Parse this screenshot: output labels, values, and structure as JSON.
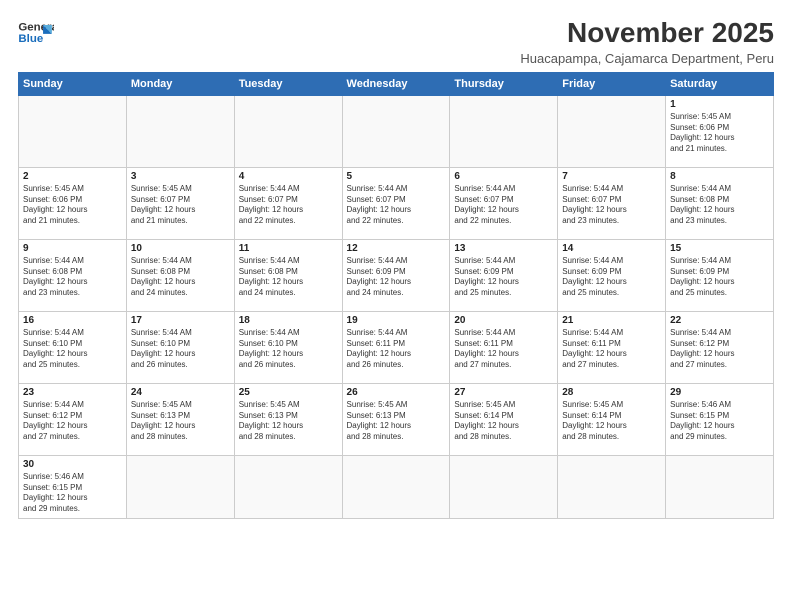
{
  "logo": {
    "line1": "General",
    "line2": "Blue"
  },
  "header": {
    "month_title": "November 2025",
    "subtitle": "Huacapampa, Cajamarca Department, Peru"
  },
  "weekdays": [
    "Sunday",
    "Monday",
    "Tuesday",
    "Wednesday",
    "Thursday",
    "Friday",
    "Saturday"
  ],
  "weeks": [
    [
      {
        "num": "",
        "info": ""
      },
      {
        "num": "",
        "info": ""
      },
      {
        "num": "",
        "info": ""
      },
      {
        "num": "",
        "info": ""
      },
      {
        "num": "",
        "info": ""
      },
      {
        "num": "",
        "info": ""
      },
      {
        "num": "1",
        "info": "Sunrise: 5:45 AM\nSunset: 6:06 PM\nDaylight: 12 hours\nand 21 minutes."
      }
    ],
    [
      {
        "num": "2",
        "info": "Sunrise: 5:45 AM\nSunset: 6:06 PM\nDaylight: 12 hours\nand 21 minutes."
      },
      {
        "num": "3",
        "info": "Sunrise: 5:45 AM\nSunset: 6:07 PM\nDaylight: 12 hours\nand 21 minutes."
      },
      {
        "num": "4",
        "info": "Sunrise: 5:44 AM\nSunset: 6:07 PM\nDaylight: 12 hours\nand 22 minutes."
      },
      {
        "num": "5",
        "info": "Sunrise: 5:44 AM\nSunset: 6:07 PM\nDaylight: 12 hours\nand 22 minutes."
      },
      {
        "num": "6",
        "info": "Sunrise: 5:44 AM\nSunset: 6:07 PM\nDaylight: 12 hours\nand 22 minutes."
      },
      {
        "num": "7",
        "info": "Sunrise: 5:44 AM\nSunset: 6:07 PM\nDaylight: 12 hours\nand 23 minutes."
      },
      {
        "num": "8",
        "info": "Sunrise: 5:44 AM\nSunset: 6:08 PM\nDaylight: 12 hours\nand 23 minutes."
      }
    ],
    [
      {
        "num": "9",
        "info": "Sunrise: 5:44 AM\nSunset: 6:08 PM\nDaylight: 12 hours\nand 23 minutes."
      },
      {
        "num": "10",
        "info": "Sunrise: 5:44 AM\nSunset: 6:08 PM\nDaylight: 12 hours\nand 24 minutes."
      },
      {
        "num": "11",
        "info": "Sunrise: 5:44 AM\nSunset: 6:08 PM\nDaylight: 12 hours\nand 24 minutes."
      },
      {
        "num": "12",
        "info": "Sunrise: 5:44 AM\nSunset: 6:09 PM\nDaylight: 12 hours\nand 24 minutes."
      },
      {
        "num": "13",
        "info": "Sunrise: 5:44 AM\nSunset: 6:09 PM\nDaylight: 12 hours\nand 25 minutes."
      },
      {
        "num": "14",
        "info": "Sunrise: 5:44 AM\nSunset: 6:09 PM\nDaylight: 12 hours\nand 25 minutes."
      },
      {
        "num": "15",
        "info": "Sunrise: 5:44 AM\nSunset: 6:09 PM\nDaylight: 12 hours\nand 25 minutes."
      }
    ],
    [
      {
        "num": "16",
        "info": "Sunrise: 5:44 AM\nSunset: 6:10 PM\nDaylight: 12 hours\nand 25 minutes."
      },
      {
        "num": "17",
        "info": "Sunrise: 5:44 AM\nSunset: 6:10 PM\nDaylight: 12 hours\nand 26 minutes."
      },
      {
        "num": "18",
        "info": "Sunrise: 5:44 AM\nSunset: 6:10 PM\nDaylight: 12 hours\nand 26 minutes."
      },
      {
        "num": "19",
        "info": "Sunrise: 5:44 AM\nSunset: 6:11 PM\nDaylight: 12 hours\nand 26 minutes."
      },
      {
        "num": "20",
        "info": "Sunrise: 5:44 AM\nSunset: 6:11 PM\nDaylight: 12 hours\nand 27 minutes."
      },
      {
        "num": "21",
        "info": "Sunrise: 5:44 AM\nSunset: 6:11 PM\nDaylight: 12 hours\nand 27 minutes."
      },
      {
        "num": "22",
        "info": "Sunrise: 5:44 AM\nSunset: 6:12 PM\nDaylight: 12 hours\nand 27 minutes."
      }
    ],
    [
      {
        "num": "23",
        "info": "Sunrise: 5:44 AM\nSunset: 6:12 PM\nDaylight: 12 hours\nand 27 minutes."
      },
      {
        "num": "24",
        "info": "Sunrise: 5:45 AM\nSunset: 6:13 PM\nDaylight: 12 hours\nand 28 minutes."
      },
      {
        "num": "25",
        "info": "Sunrise: 5:45 AM\nSunset: 6:13 PM\nDaylight: 12 hours\nand 28 minutes."
      },
      {
        "num": "26",
        "info": "Sunrise: 5:45 AM\nSunset: 6:13 PM\nDaylight: 12 hours\nand 28 minutes."
      },
      {
        "num": "27",
        "info": "Sunrise: 5:45 AM\nSunset: 6:14 PM\nDaylight: 12 hours\nand 28 minutes."
      },
      {
        "num": "28",
        "info": "Sunrise: 5:45 AM\nSunset: 6:14 PM\nDaylight: 12 hours\nand 28 minutes."
      },
      {
        "num": "29",
        "info": "Sunrise: 5:46 AM\nSunset: 6:15 PM\nDaylight: 12 hours\nand 29 minutes."
      }
    ],
    [
      {
        "num": "30",
        "info": "Sunrise: 5:46 AM\nSunset: 6:15 PM\nDaylight: 12 hours\nand 29 minutes."
      },
      {
        "num": "",
        "info": ""
      },
      {
        "num": "",
        "info": ""
      },
      {
        "num": "",
        "info": ""
      },
      {
        "num": "",
        "info": ""
      },
      {
        "num": "",
        "info": ""
      },
      {
        "num": "",
        "info": ""
      }
    ]
  ]
}
